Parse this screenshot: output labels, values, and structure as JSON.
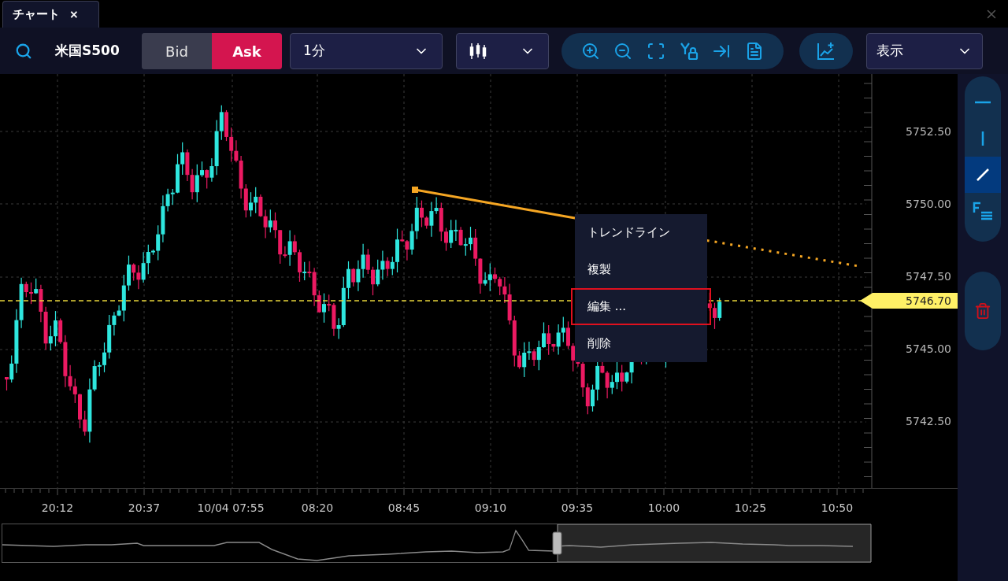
{
  "tab": {
    "label": "チャート",
    "close": "×"
  },
  "toolbar": {
    "symbol": "米国S500",
    "sides": [
      {
        "label": "Bid",
        "selected": false
      },
      {
        "label": "Ask",
        "selected": true
      }
    ],
    "interval": "1分",
    "view_menu": "表示"
  },
  "drawing_tools": [
    {
      "kind": "horizontal",
      "selected": false
    },
    {
      "kind": "vertical",
      "selected": false
    },
    {
      "kind": "trend",
      "selected": true
    },
    {
      "kind": "fibonacci",
      "selected": false
    }
  ],
  "price_axis": {
    "ticks": [
      "5752.50",
      "5750.00",
      "5747.50",
      "5745.00",
      "5742.50"
    ],
    "current_price": "5746.70"
  },
  "time_axis": {
    "labels": [
      "20:12",
      "20:37",
      "10/04 07:55",
      "08:20",
      "08:45",
      "09:10",
      "09:35",
      "10:00",
      "10:25",
      "10:50"
    ]
  },
  "context_menu": {
    "items": [
      {
        "label": "トレンドライン",
        "selected": false
      },
      {
        "label": "複製",
        "selected": false
      },
      {
        "label": "編集 ...",
        "selected": true
      },
      {
        "label": "削除",
        "selected": false
      }
    ]
  }
}
